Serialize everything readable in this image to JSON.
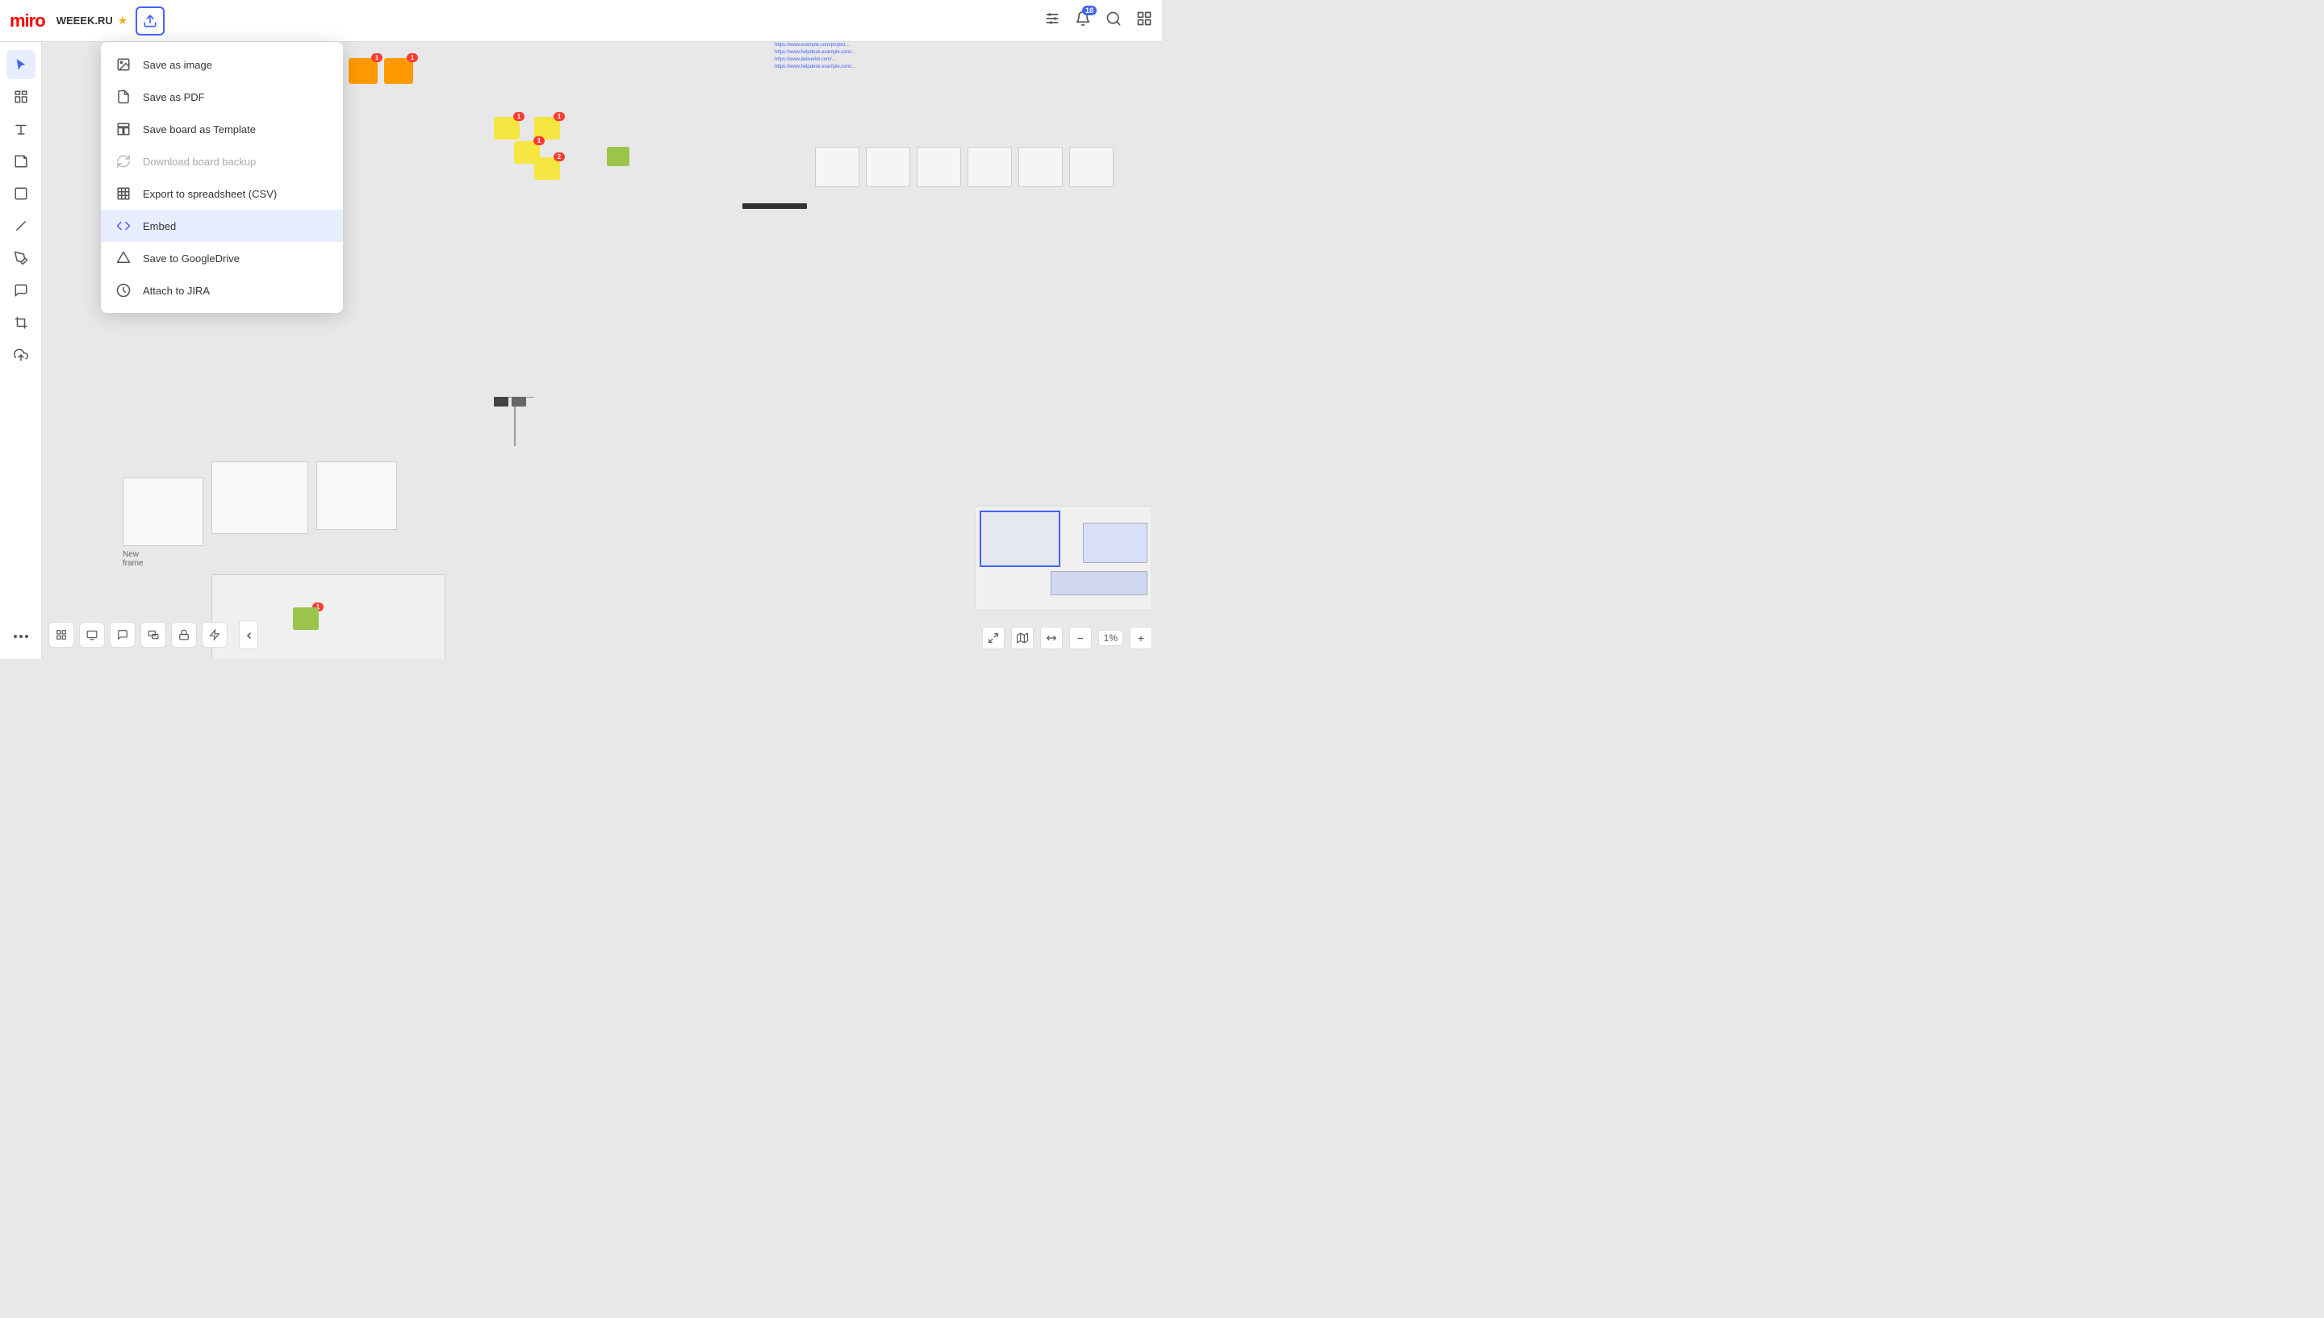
{
  "app": {
    "name": "miro",
    "logo_text": "miro"
  },
  "topbar": {
    "board_name": "WEEEK.RU",
    "export_button_label": "Export",
    "badge_count": "18",
    "icons": {
      "settings": "⚙",
      "notifications": "🔔",
      "search": "🔍",
      "grid": "⊞"
    }
  },
  "sidebar": {
    "items": [
      {
        "id": "cursor",
        "icon": "cursor",
        "label": "Select",
        "active": true
      },
      {
        "id": "frames",
        "icon": "frames",
        "label": "Frames"
      },
      {
        "id": "text",
        "icon": "text",
        "label": "Text"
      },
      {
        "id": "sticky",
        "icon": "sticky",
        "label": "Sticky Note"
      },
      {
        "id": "shape",
        "icon": "shape",
        "label": "Shape"
      },
      {
        "id": "pen",
        "icon": "pen",
        "label": "Pen"
      },
      {
        "id": "comment",
        "icon": "comment",
        "label": "Comment"
      },
      {
        "id": "crop",
        "icon": "crop",
        "label": "Crop"
      },
      {
        "id": "upload",
        "icon": "upload",
        "label": "Upload"
      }
    ],
    "more_label": "More"
  },
  "dropdown_menu": {
    "items": [
      {
        "id": "save-image",
        "label": "Save as image",
        "icon": "image",
        "disabled": false,
        "highlighted": false
      },
      {
        "id": "save-pdf",
        "label": "Save as PDF",
        "icon": "pdf",
        "disabled": false,
        "highlighted": false
      },
      {
        "id": "save-template",
        "label": "Save board as Template",
        "icon": "template",
        "disabled": false,
        "highlighted": false
      },
      {
        "id": "download-backup",
        "label": "Download board backup",
        "icon": "backup",
        "disabled": true,
        "highlighted": false
      },
      {
        "id": "export-csv",
        "label": "Export to spreadsheet (CSV)",
        "icon": "csv",
        "disabled": false,
        "highlighted": false
      },
      {
        "id": "embed",
        "label": "Embed",
        "icon": "embed",
        "disabled": false,
        "highlighted": true
      },
      {
        "id": "save-gdrive",
        "label": "Save to GoogleDrive",
        "icon": "gdrive",
        "disabled": false,
        "highlighted": false
      },
      {
        "id": "attach-jira",
        "label": "Attach to JIRA",
        "icon": "jira",
        "disabled": false,
        "highlighted": false
      }
    ]
  },
  "zoom_controls": {
    "zoom_level": "1%",
    "fit_label": "Fit",
    "zoom_in_label": "+",
    "zoom_out_label": "−"
  },
  "bottom_toolbar": {
    "items": [
      {
        "id": "grid",
        "label": "Grid"
      },
      {
        "id": "present",
        "label": "Present"
      },
      {
        "id": "chat",
        "label": "Chat"
      },
      {
        "id": "multiscreen",
        "label": "Multiscreen"
      },
      {
        "id": "share",
        "label": "Share"
      },
      {
        "id": "integrations",
        "label": "Integrations"
      },
      {
        "id": "collapse",
        "label": "Collapse"
      }
    ]
  },
  "board": {
    "frame_label": "New frame"
  }
}
